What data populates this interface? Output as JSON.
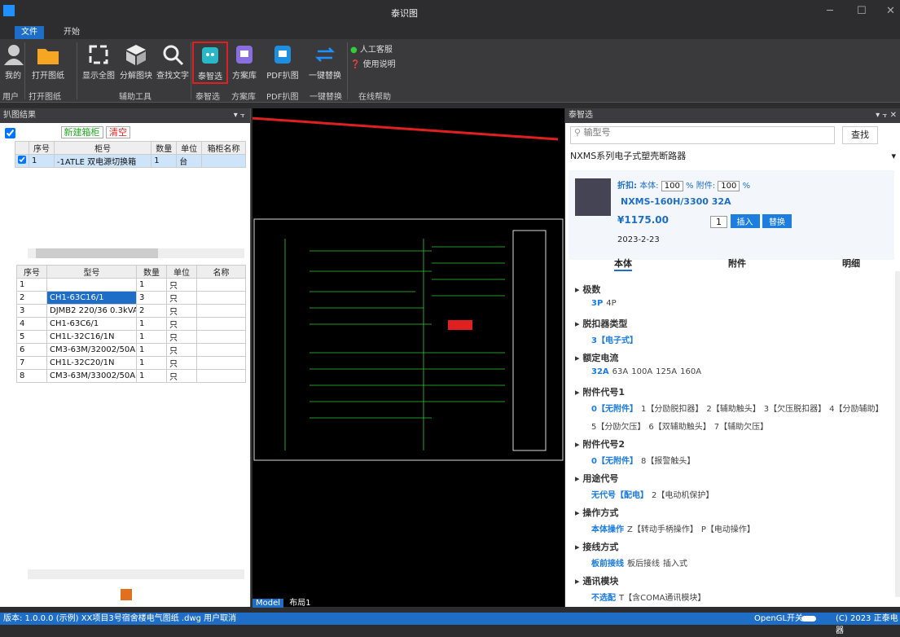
{
  "app": {
    "title": "泰识图"
  },
  "menu": {
    "file": "文件",
    "start": "开始"
  },
  "ribbon": {
    "buttons": [
      {
        "name": "my-button",
        "label": "我的"
      },
      {
        "name": "open-drawing-button",
        "label": "打开图纸"
      },
      {
        "name": "show-all-button",
        "label": "显示全图"
      },
      {
        "name": "explode-block-button",
        "label": "分解图块"
      },
      {
        "name": "find-text-button",
        "label": "查找文字"
      },
      {
        "name": "taizhixuan-button",
        "label": "泰智选"
      },
      {
        "name": "scheme-library-button",
        "label": "方案库"
      },
      {
        "name": "pdf-capture-button",
        "label": "PDF扒图"
      },
      {
        "name": "one-key-replace-button",
        "label": "一键替换"
      }
    ],
    "groups": [
      "用户",
      "打开图纸",
      "辅助工具",
      "泰智选",
      "方案库",
      "PDF扒图",
      "一键替换",
      "在线帮助"
    ],
    "help": {
      "service": "人工客服",
      "manual": "使用说明"
    }
  },
  "left": {
    "title": "扒图结果",
    "new_cabinet": "新建箱柜",
    "clear": "清空",
    "top_headers": [
      "序号",
      "柜号",
      "数量",
      "单位",
      "箱柜名称"
    ],
    "top_rows": [
      {
        "no": "1",
        "cab": "-1ATLE 双电源切换箱",
        "qty": "1",
        "unit": "台",
        "name": ""
      }
    ],
    "bot_headers": [
      "序号",
      "型号",
      "数量",
      "单位",
      "名称"
    ],
    "bot_rows": [
      {
        "no": "1",
        "model": "",
        "qty": "1",
        "unit": "只"
      },
      {
        "no": "2",
        "model": "CH1-63C16/1",
        "qty": "3",
        "unit": "只"
      },
      {
        "no": "3",
        "model": "DJMB2 220/36 0.3kVA",
        "qty": "2",
        "unit": "只"
      },
      {
        "no": "4",
        "model": "CH1-63C6/1",
        "qty": "1",
        "unit": "只"
      },
      {
        "no": "5",
        "model": "CH1L-32C16/1N",
        "qty": "1",
        "unit": "只"
      },
      {
        "no": "6",
        "model": "CM3-63M/32002/50A",
        "qty": "1",
        "unit": "只"
      },
      {
        "no": "7",
        "model": "CH1L-32C20/1N",
        "qty": "1",
        "unit": "只"
      },
      {
        "no": "8",
        "model": "CM3-63M/33002/50A",
        "qty": "1",
        "unit": "只"
      }
    ]
  },
  "canvas": {
    "tab_model": "Model",
    "tab_layout": "布局1"
  },
  "right": {
    "title": "泰智选",
    "search_placeholder": "输型号",
    "search_btn": "查找",
    "series": "NXMS系列电子式塑壳断路器",
    "discount_label": "折扣:",
    "body_label": "本体:",
    "body_val": "100",
    "pct": "%",
    "acc_label": "附件:",
    "acc_val": "100",
    "model": "NXMS-160H/3300 32A",
    "price": "¥1175.00",
    "qty": "1",
    "insert": "插入",
    "replace": "替换",
    "date": "2023-2-23",
    "tabs": [
      "本体",
      "附件",
      "明细"
    ],
    "attrs": [
      {
        "name": "极数",
        "vals": [
          {
            "t": "3P",
            "s": true
          },
          {
            "t": "4P",
            "s": false
          }
        ]
      },
      {
        "name": "脱扣器类型",
        "vals": [
          {
            "t": "3【电子式】",
            "s": true
          }
        ]
      },
      {
        "name": "额定电流",
        "vals": [
          {
            "t": "32A",
            "s": true
          },
          {
            "t": "63A",
            "s": false
          },
          {
            "t": "100A",
            "s": false
          },
          {
            "t": "125A",
            "s": false
          },
          {
            "t": "160A",
            "s": false
          }
        ]
      },
      {
        "name": "附件代号1",
        "vals": [
          {
            "t": "0【无附件】",
            "s": true
          },
          {
            "t": "1【分励脱扣器】",
            "s": false
          },
          {
            "t": "2【辅助触头】",
            "s": false
          },
          {
            "t": "3【欠压脱扣器】",
            "s": false
          },
          {
            "t": "4【分励辅助】",
            "s": false
          }
        ],
        "vals2": [
          {
            "t": "5【分励欠压】",
            "s": false
          },
          {
            "t": "6【双辅助触头】",
            "s": false
          },
          {
            "t": "7【辅助欠压】",
            "s": false
          }
        ]
      },
      {
        "name": "附件代号2",
        "vals": [
          {
            "t": "0【无附件】",
            "s": true
          },
          {
            "t": "8【报警触头】",
            "s": false
          }
        ]
      },
      {
        "name": "用途代号",
        "vals": [
          {
            "t": "无代号【配电】",
            "s": true
          },
          {
            "t": "2【电动机保护】",
            "s": false
          }
        ]
      },
      {
        "name": "操作方式",
        "vals": [
          {
            "t": "本体操作",
            "s": true
          },
          {
            "t": "Z【转动手柄操作】",
            "s": false
          },
          {
            "t": "P【电动操作】",
            "s": false
          }
        ]
      },
      {
        "name": "接线方式",
        "vals": [
          {
            "t": "板前接线",
            "s": true
          },
          {
            "t": "板后接线",
            "s": false
          },
          {
            "t": "插入式",
            "s": false
          }
        ]
      },
      {
        "name": "通讯模块",
        "vals": [
          {
            "t": "不选配",
            "s": true
          },
          {
            "t": "T【含COMA通讯模块】",
            "s": false
          }
        ]
      }
    ]
  },
  "status": {
    "left": "版本: 1.0.0.0   (示例) XX项目3号宿舍楼电气图纸 .dwg  用户取消",
    "opengl": "OpenGL开关",
    "copyright": "(C) 2023 正泰电器"
  }
}
